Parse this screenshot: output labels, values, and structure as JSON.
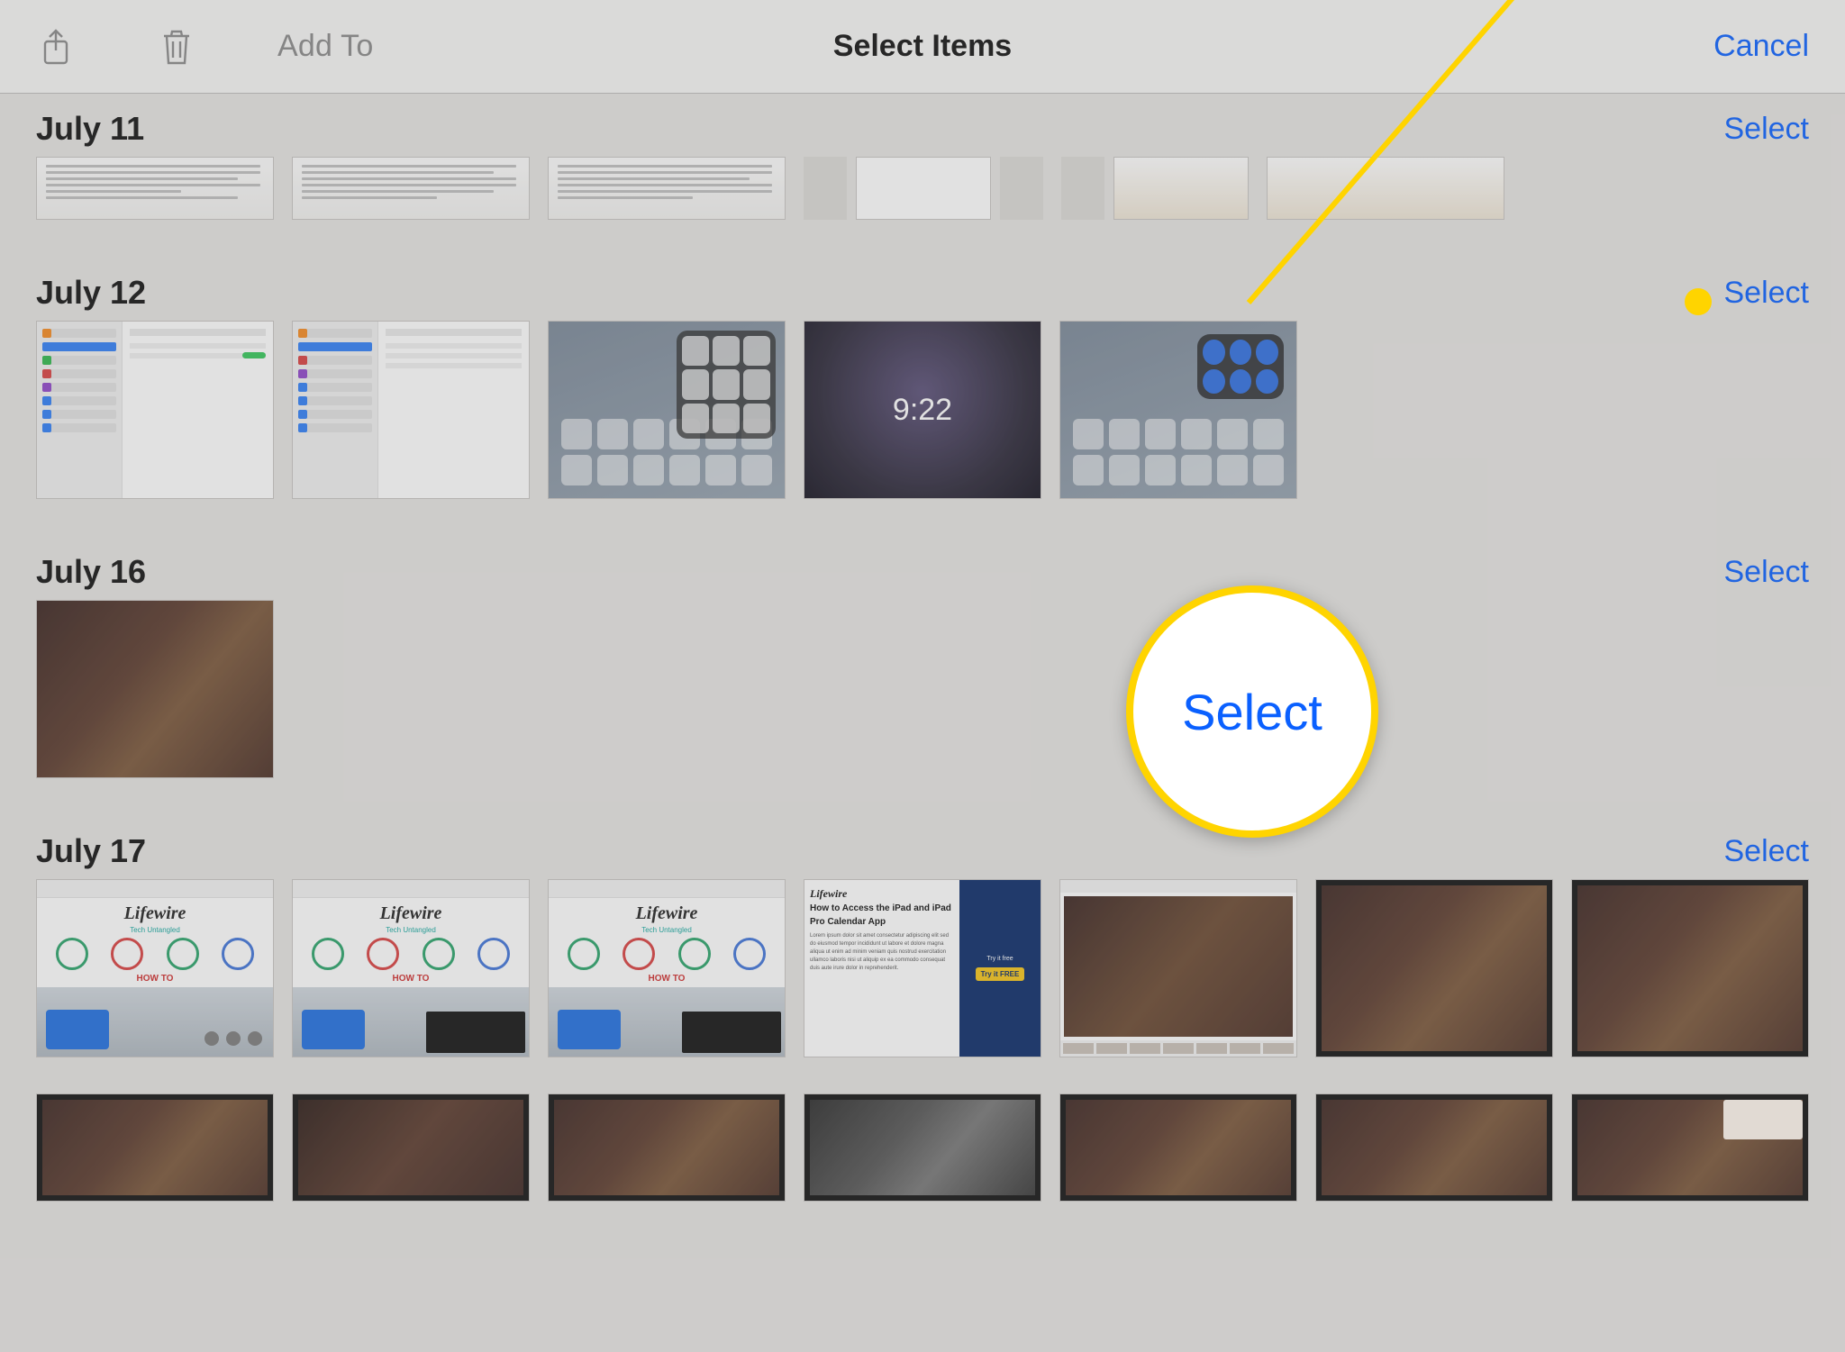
{
  "toolbar": {
    "add_to": "Add To",
    "title": "Select Items",
    "cancel": "Cancel"
  },
  "sections": [
    {
      "date": "July 11",
      "select": "Select"
    },
    {
      "date": "July 12",
      "select": "Select"
    },
    {
      "date": "July 16",
      "select": "Select"
    },
    {
      "date": "July 17",
      "select": "Select"
    }
  ],
  "callout": {
    "label": "Select"
  },
  "lifewire": {
    "brand": "Lifewire",
    "tagline": "Tech Untangled",
    "howto": "HOW TO",
    "try_free": "Try it FREE"
  },
  "lockscreen": {
    "time": "9:22"
  }
}
